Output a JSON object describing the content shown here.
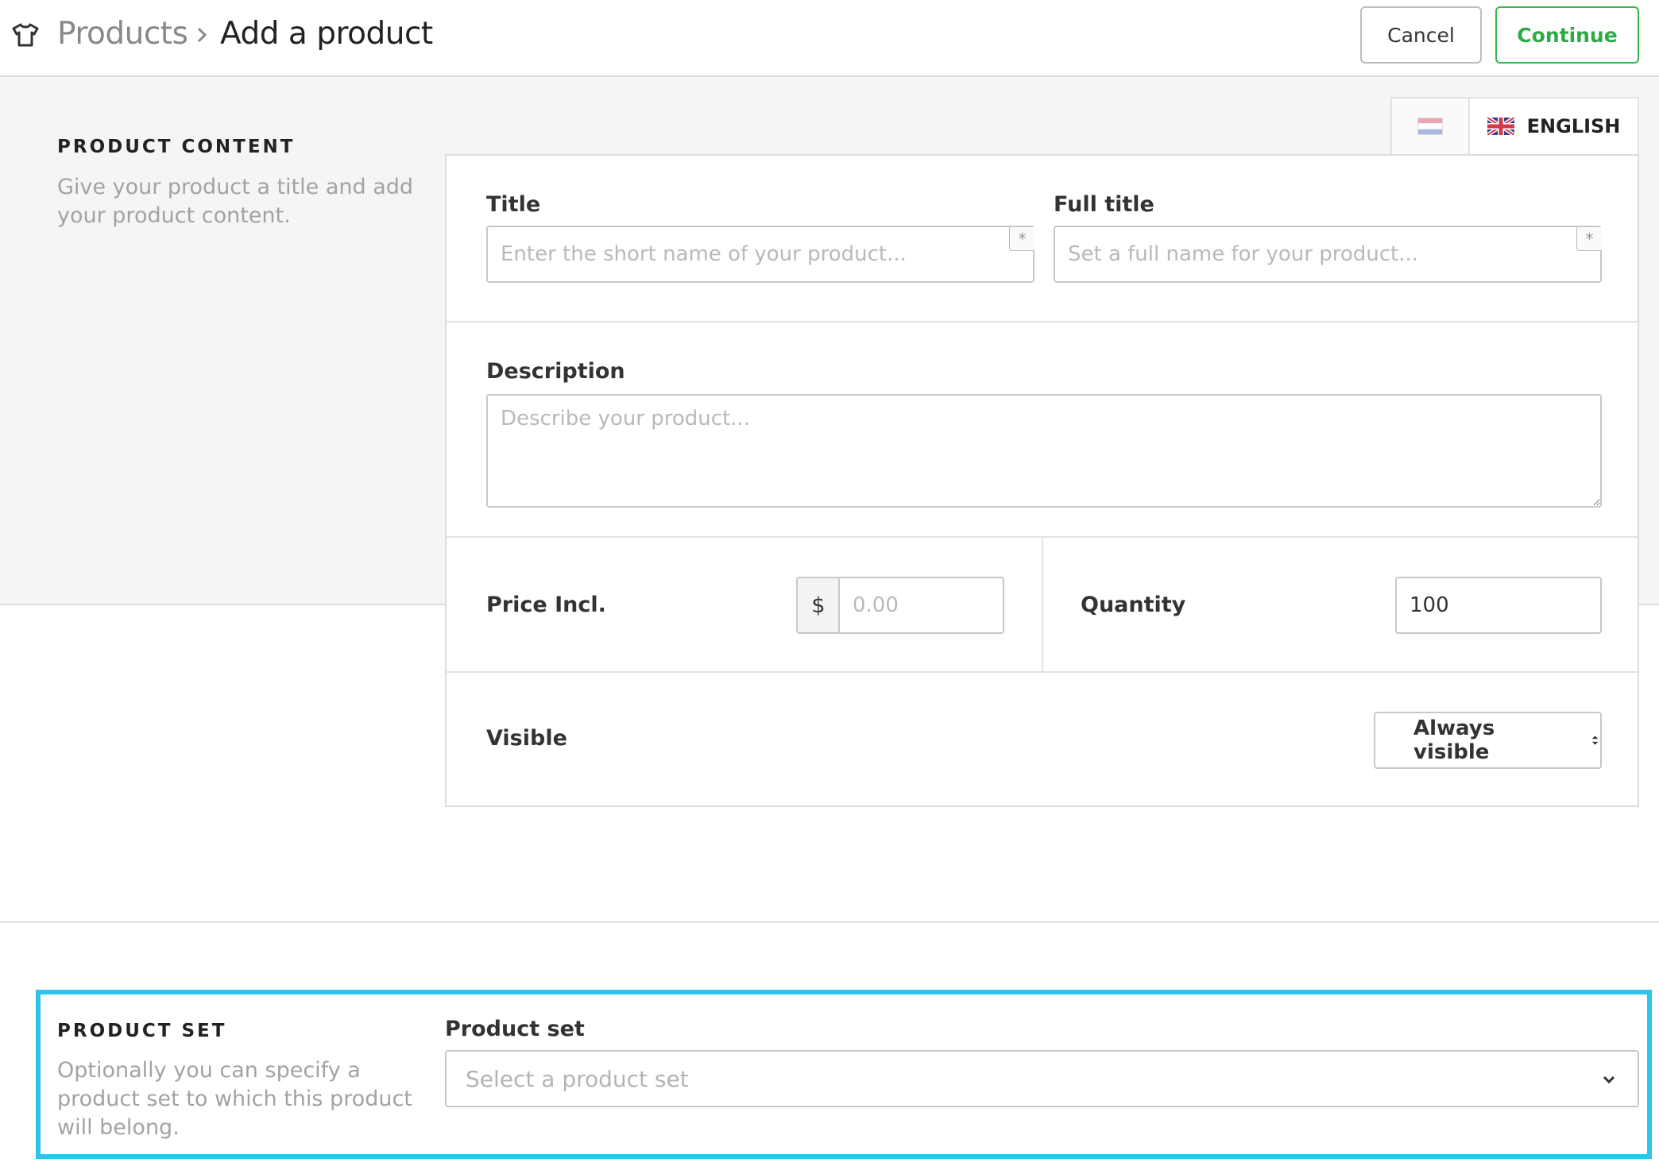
{
  "header": {
    "breadcrumb_root": "Products",
    "breadcrumb_current": "Add a product",
    "cancel_label": "Cancel",
    "continue_label": "Continue"
  },
  "product_content": {
    "heading": "PRODUCT CONTENT",
    "description_line1": "Give your product a title and add",
    "description_line2": "your product content."
  },
  "languages": {
    "active_label": "ENGLISH"
  },
  "form": {
    "title_label": "Title",
    "title_placeholder": "Enter the short name of your product...",
    "full_title_label": "Full title",
    "full_title_placeholder": "Set a full name for your product...",
    "required_mark": "*",
    "description_label": "Description",
    "description_placeholder": "Describe your product...",
    "price_label": "Price Incl.",
    "currency_symbol": "$",
    "price_placeholder": "0.00",
    "quantity_label": "Quantity",
    "quantity_value": "100",
    "visible_label": "Visible",
    "visible_value": "Always visible"
  },
  "product_set": {
    "heading": "PRODUCT SET",
    "description_line1": "Optionally you can specify a",
    "description_line2": "product set to which this product",
    "description_line3": "will belong.",
    "field_label": "Product set",
    "select_placeholder": "Select a product set"
  },
  "colors": {
    "accent_green": "#3bb34e",
    "highlight_blue": "#2fc4ee"
  }
}
